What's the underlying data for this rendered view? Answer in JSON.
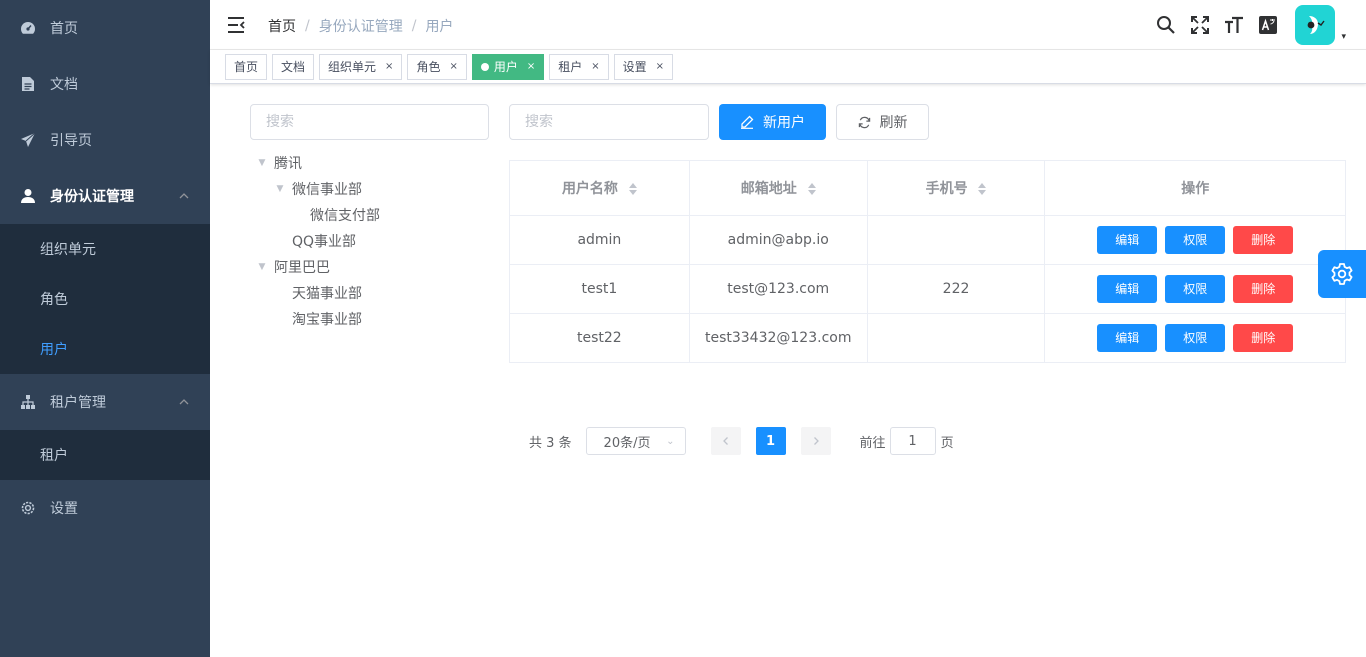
{
  "sidebar": {
    "items": [
      {
        "label": "首页",
        "icon": "dashboard-icon"
      },
      {
        "label": "文档",
        "icon": "document-icon"
      },
      {
        "label": "引导页",
        "icon": "guide-icon"
      },
      {
        "label": "身份认证管理",
        "icon": "user-icon",
        "expanded": true,
        "children": [
          {
            "label": "组织单元"
          },
          {
            "label": "角色"
          },
          {
            "label": "用户",
            "active": true
          }
        ]
      },
      {
        "label": "租户管理",
        "icon": "tree-icon",
        "expanded": true,
        "children": [
          {
            "label": "租户"
          }
        ]
      },
      {
        "label": "设置",
        "icon": "gear-icon"
      }
    ],
    "colors": {
      "background": "#304156",
      "submenu_background": "#1f2d3d",
      "active_text": "#409eff"
    }
  },
  "header": {
    "breadcrumb": [
      "首页",
      "身份认证管理",
      "用户"
    ],
    "separator": "/",
    "icons": [
      "search-icon",
      "fullscreen-icon",
      "font-size-icon",
      "language-icon"
    ],
    "avatar_caret": "▾"
  },
  "tags": [
    {
      "label": "首页",
      "closable": false
    },
    {
      "label": "文档",
      "closable": false
    },
    {
      "label": "组织单元",
      "closable": true
    },
    {
      "label": "角色",
      "closable": true
    },
    {
      "label": "用户",
      "closable": true,
      "active": true
    },
    {
      "label": "租户",
      "closable": true
    },
    {
      "label": "设置",
      "closable": true
    }
  ],
  "tag_close": "×",
  "org": {
    "search_placeholder": "搜索",
    "tree": [
      {
        "label": "腾讯",
        "level": 0,
        "expanded": true
      },
      {
        "label": "微信事业部",
        "level": 1,
        "expanded": true
      },
      {
        "label": "微信支付部",
        "level": 2,
        "leaf": true
      },
      {
        "label": "QQ事业部",
        "level": 1,
        "leaf": true
      },
      {
        "label": "阿里巴巴",
        "level": 0,
        "expanded": true
      },
      {
        "label": "天猫事业部",
        "level": 1,
        "leaf": true
      },
      {
        "label": "淘宝事业部",
        "level": 1,
        "leaf": true
      }
    ]
  },
  "toolbar": {
    "search_placeholder": "搜索",
    "new_user_label": "新用户",
    "refresh_label": "刷新"
  },
  "table": {
    "columns": [
      "用户名称",
      "邮箱地址",
      "手机号",
      "操作"
    ],
    "rows": [
      {
        "name": "admin",
        "email": "admin@abp.io",
        "phone": ""
      },
      {
        "name": "test1",
        "email": "test@123.com",
        "phone": "222"
      },
      {
        "name": "test22",
        "email": "test33432@123.com",
        "phone": ""
      }
    ],
    "actions": {
      "edit": "编辑",
      "permission": "权限",
      "delete": "删除"
    }
  },
  "pagination": {
    "total_label": "共 3 条",
    "page_size": "20条/页",
    "current_page": "1",
    "goto_prefix": "前往",
    "goto_value": "1",
    "goto_suffix": "页"
  },
  "colors": {
    "primary": "#1890ff",
    "danger": "#ff4949",
    "tag_active": "#42b983"
  }
}
